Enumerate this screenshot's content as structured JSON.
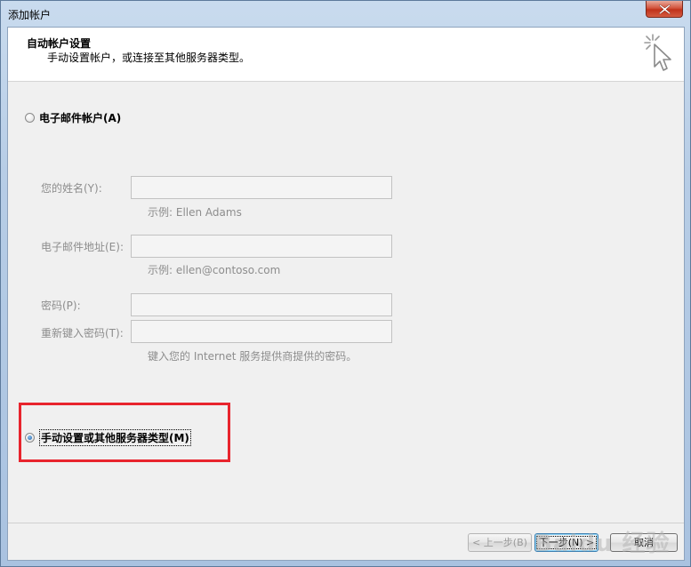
{
  "window": {
    "title": "添加帐户"
  },
  "header": {
    "title": "自动帐户设置",
    "subtitle": "手动设置帐户，或连接至其他服务器类型。",
    "icon": "cursor-sparkle-icon"
  },
  "options": {
    "email_account_label": "电子邮件帐户(A)",
    "manual_setup_label": "手动设置或其他服务器类型(M)",
    "selected": "manual_setup"
  },
  "form": {
    "name_label": "您的姓名(Y):",
    "name_value": "",
    "name_hint": "示例: Ellen Adams",
    "email_label": "电子邮件地址(E):",
    "email_value": "",
    "email_hint": "示例: ellen@contoso.com",
    "password_label": "密码(P):",
    "password_value": "",
    "retype_label": "重新键入密码(T):",
    "retype_value": "",
    "password_hint": "键入您的 Internet 服务提供商提供的密码。"
  },
  "buttons": {
    "back_label": "< 上一步(B)",
    "next_label": "下一步(N) >",
    "cancel_label": "取消"
  },
  "watermark": {
    "text": "Baidu 经验"
  },
  "colors": {
    "highlight_box": "#e8242d",
    "titlebar": "#b7cde6",
    "client_bg": "#f0f0f0"
  }
}
